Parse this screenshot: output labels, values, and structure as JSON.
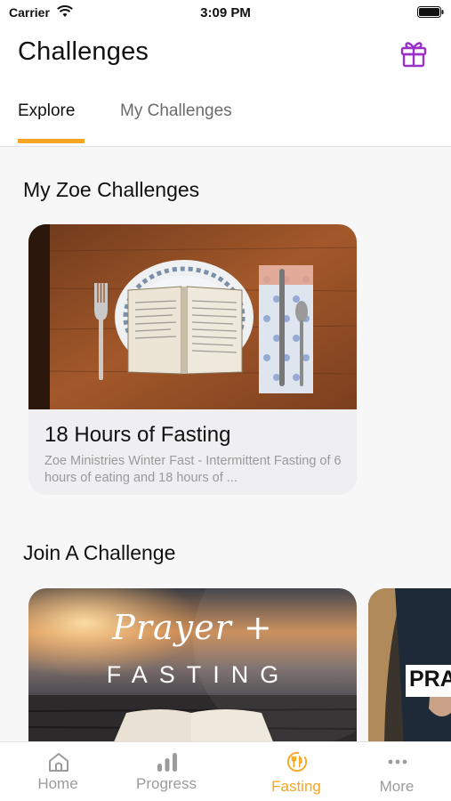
{
  "status_bar": {
    "carrier": "Carrier",
    "time": "3:09 PM"
  },
  "header": {
    "title": "Challenges",
    "gift_icon": "gift-icon",
    "tabs": [
      {
        "label": "Explore",
        "active": true
      },
      {
        "label": "My Challenges",
        "active": false
      }
    ]
  },
  "sections": {
    "my_challenges_title": "My Zoe Challenges",
    "join_title": "Join A Challenge"
  },
  "my_challenges": [
    {
      "title": "18 Hours of Fasting",
      "description": "Zoe Ministries Winter Fast - Intermittent Fasting of 6 hours of eating and 18 hours of ...",
      "image": "table-setting-with-open-bible"
    }
  ],
  "join_challenges": [
    {
      "script_text": "Prayer +",
      "caps_text": "FASTING",
      "image": "sunset-over-water-with-bible"
    },
    {
      "label": "PRA",
      "image": "person-dark-clothing"
    }
  ],
  "tab_bar": {
    "items": [
      {
        "label": "Home",
        "icon": "home-icon",
        "active": false
      },
      {
        "label": "Progress",
        "icon": "bar-chart-icon",
        "active": false
      },
      {
        "label": "Fasting",
        "icon": "fasting-utensils-icon",
        "active": true
      },
      {
        "label": "More",
        "icon": "more-dots-icon",
        "active": false
      }
    ]
  },
  "colors": {
    "accent": "#f5a623",
    "gift": "#9b30c8",
    "inactive": "#9b9b9b"
  }
}
